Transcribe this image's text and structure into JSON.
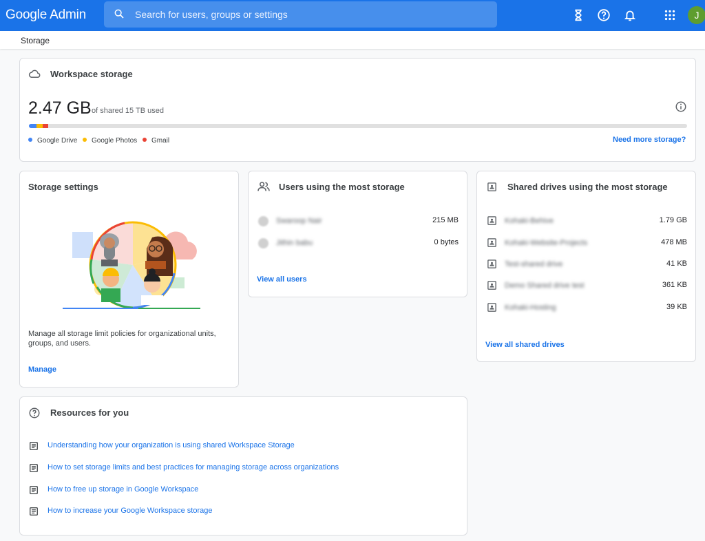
{
  "header": {
    "logo": "Google Admin",
    "search_placeholder": "Search for users, groups or settings",
    "avatar_letter": "J"
  },
  "breadcrumb": "Storage",
  "workspace_storage": {
    "title": "Workspace storage",
    "used": "2.47 GB",
    "used_suffix": "of shared 15 TB used",
    "segments": [
      {
        "name": "Google Drive",
        "color": "#4285f4",
        "percent": 1.2
      },
      {
        "name": "Google Photos",
        "color": "#fbbc04",
        "percent": 0.9
      },
      {
        "name": "Gmail",
        "color": "#ea4335",
        "percent": 0.8
      }
    ],
    "legend": [
      "Google Drive",
      "Google Photos",
      "Gmail"
    ],
    "link": "Need more storage?"
  },
  "storage_settings": {
    "title": "Storage settings",
    "description": "Manage all storage limit policies for organizational units, groups, and users.",
    "link": "Manage"
  },
  "users_storage": {
    "title": "Users using the most storage",
    "rows": [
      {
        "name": "Swaroop Nair",
        "value": "215 MB"
      },
      {
        "name": "Jithin babu",
        "value": "0 bytes"
      }
    ],
    "link": "View all users"
  },
  "shared_drives": {
    "title": "Shared drives using the most storage",
    "rows": [
      {
        "name": "Kohaki-Behive",
        "value": "1.79 GB"
      },
      {
        "name": "Kohaki-Website-Projects",
        "value": "478 MB"
      },
      {
        "name": "Test-shared drive",
        "value": "41 KB"
      },
      {
        "name": "Demo Shared drive test",
        "value": "361 KB"
      },
      {
        "name": "Kohaki-Hosting",
        "value": "39 KB"
      }
    ],
    "link": "View all shared drives"
  },
  "resources": {
    "title": "Resources for you",
    "items": [
      "Understanding how your organization is using shared Workspace Storage",
      "How to set storage limits and best practices for managing storage across organizations",
      "How to free up storage in Google Workspace",
      "How to increase your Google Workspace storage"
    ]
  },
  "colors": {
    "accent": "#1a73e8",
    "drive": "#4285f4",
    "photos": "#fbbc04",
    "gmail": "#ea4335"
  }
}
